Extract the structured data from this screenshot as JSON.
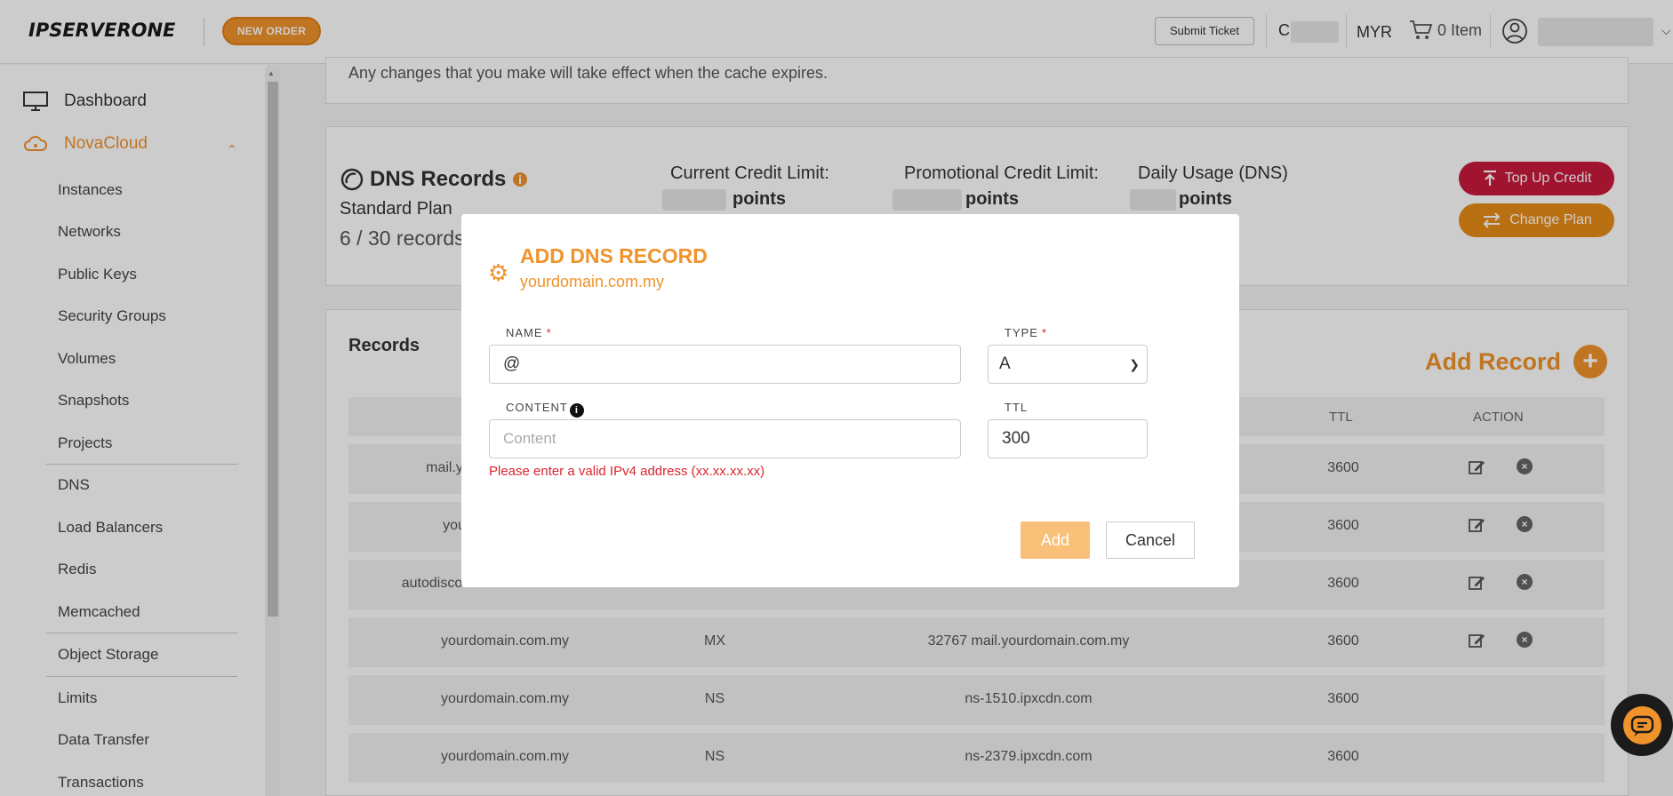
{
  "header": {
    "logo_text": "IPSERVERONE",
    "new_order_label": "NEW ORDER",
    "submit_ticket_label": "Submit Ticket",
    "credit_prefix": "C",
    "currency": "MYR",
    "cart_label": "0 Item"
  },
  "sidebar": {
    "main_items": [
      {
        "label": "Dashboard",
        "icon": "monitor-icon"
      },
      {
        "label": "NovaCloud",
        "icon": "cloud-icon"
      }
    ],
    "sub_items": [
      "Instances",
      "Networks",
      "Public Keys",
      "Security Groups",
      "Volumes",
      "Snapshots",
      "Projects",
      "DNS",
      "Load Balancers",
      "Redis",
      "Memcached",
      "Object Storage",
      "Limits",
      "Data Transfer",
      "Transactions"
    ]
  },
  "main": {
    "cache_notice": "Any changes that you make will take effect when the cache expires.",
    "dns_title": "DNS Records",
    "plan": "Standard Plan",
    "records_count": "6 / 30 records",
    "current_credit_label": "Current Credit Limit:",
    "promo_credit_label": "Promotional Credit Limit:",
    "daily_usage_label": "Daily Usage (DNS)",
    "points_label": "points",
    "top_up_label": "Top Up Credit",
    "change_plan_label": "Change Plan",
    "records_title": "Records",
    "add_record_label": "Add Record",
    "table": {
      "headers": {
        "ttl": "TTL",
        "action": "ACTION"
      },
      "rows": [
        {
          "name": "mail.y",
          "type": "",
          "content": "",
          "ttl": "3600",
          "editable": true
        },
        {
          "name": "you",
          "type": "",
          "content": "",
          "ttl": "3600",
          "editable": true
        },
        {
          "name": "autodisco",
          "type": "",
          "content": "",
          "ttl": "3600",
          "editable": true
        },
        {
          "name": "yourdomain.com.my",
          "type": "MX",
          "content": "32767 mail.yourdomain.com.my",
          "ttl": "3600",
          "editable": true
        },
        {
          "name": "yourdomain.com.my",
          "type": "NS",
          "content": "ns-1510.ipxcdn.com",
          "ttl": "3600",
          "editable": false
        },
        {
          "name": "yourdomain.com.my",
          "type": "NS",
          "content": "ns-2379.ipxcdn.com",
          "ttl": "3600",
          "editable": false
        }
      ]
    }
  },
  "modal": {
    "title": "ADD DNS RECORD",
    "domain": "yourdomain.com.my",
    "name_label": "NAME",
    "name_value": "@",
    "type_label": "TYPE",
    "type_value": "A",
    "content_label": "CONTENT",
    "content_placeholder": "Content",
    "ttl_label": "TTL",
    "ttl_value": "300",
    "error": "Please enter a valid IPv4 address (xx.xx.xx.xx)",
    "add_label": "Add",
    "cancel_label": "Cancel",
    "required_mark": "*"
  },
  "colors": {
    "accent": "#f0932b",
    "danger": "#c8193c",
    "error": "#d9252f"
  }
}
